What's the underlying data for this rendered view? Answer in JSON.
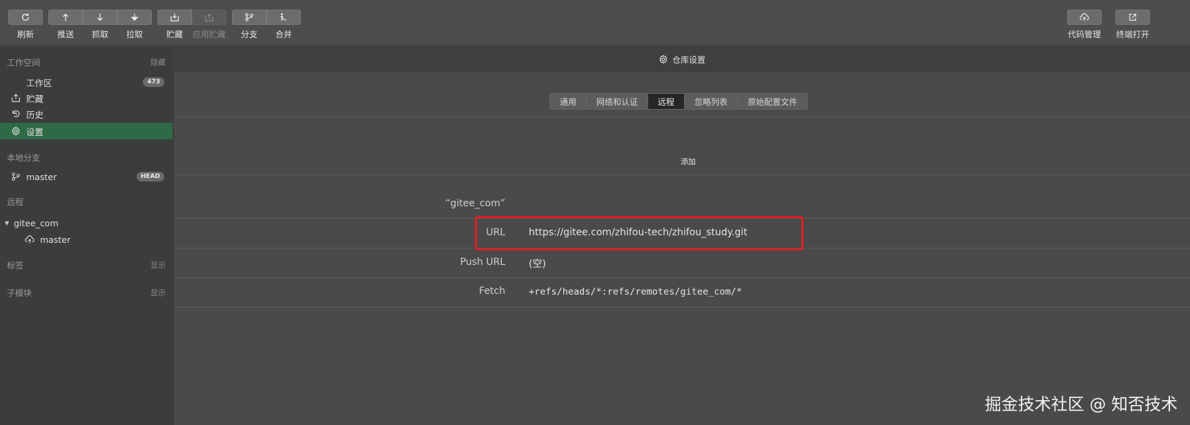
{
  "toolbar": {
    "refresh": "刷新",
    "push": "推送",
    "fetch": "抓取",
    "pull": "拉取",
    "stash": "贮藏",
    "apply_stash": "应用贮藏",
    "branch": "分支",
    "merge": "合并",
    "code_manage": "代码管理",
    "terminal": "终端打开"
  },
  "sidebar": {
    "workspace_title": "工作空间",
    "workspace_action": "隐藏",
    "workarea": "工作区",
    "workarea_count": "473",
    "stash": "贮藏",
    "history": "历史",
    "settings": "设置",
    "local_branch_title": "本地分支",
    "local_branch": "master",
    "head_badge": "HEAD",
    "remote_title": "远程",
    "remote_name": "gitee_com",
    "remote_branch": "master",
    "tags_title": "标签",
    "tags_action": "显示",
    "submodules_title": "子模块",
    "submodules_action": "显示"
  },
  "main": {
    "header": "仓库设置",
    "tabs": [
      "通用",
      "网络和认证",
      "远程",
      "忽略列表",
      "原始配置文件"
    ],
    "active_tab": 2,
    "add_button": "添加",
    "remote_name": "“gitee_com”",
    "rows": [
      {
        "label": "URL",
        "value": "https://gitee.com/zhifou-tech/zhifou_study.git"
      },
      {
        "label": "Push URL",
        "value": "(空)"
      },
      {
        "label": "Fetch",
        "value": "+refs/heads/*:refs/remotes/gitee_com/*"
      }
    ]
  },
  "watermark": "掘金技术社区 @ 知否技术",
  "colors": {
    "accent_active": "#2f6a47",
    "highlight_box": "#e02020"
  }
}
